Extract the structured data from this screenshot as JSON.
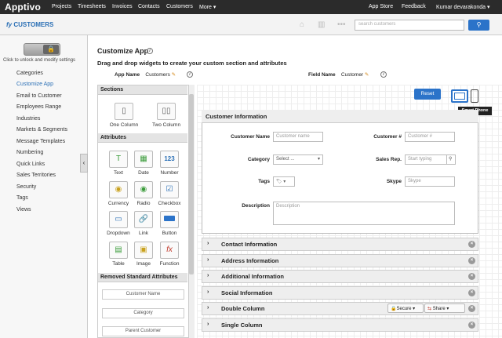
{
  "topnav": {
    "logo": "Apptivo",
    "items": [
      "Projects",
      "Timesheets",
      "Invoices",
      "Contacts",
      "Customers",
      "More ▾"
    ],
    "app_store": "App Store",
    "feedback": "Feedback",
    "user": "Kumar devarakonda ▾"
  },
  "appbar": {
    "title": "CUSTOMERS",
    "search_placeholder": "search customers"
  },
  "sidebar": {
    "unlock_text": "Click to unlock and modify settings",
    "items": [
      "Categories",
      "Customize App",
      "Email to Customer",
      "Employees Range",
      "Industries",
      "Markets & Segments",
      "Message Templates",
      "Numbering",
      "Quick Links",
      "Sales Territories",
      "Security",
      "Tags",
      "Views"
    ],
    "active": "Customize App"
  },
  "main": {
    "title": "Customize App",
    "subtitle": "Drag and drop widgets to create your custom section and attributes",
    "app_name_label": "App Name",
    "app_name_value": "Customers",
    "field_name_label": "Field Name",
    "field_name_value": "Customer"
  },
  "panel": {
    "sections_head": "Sections",
    "sections": [
      "One Column",
      "Two Column"
    ],
    "attributes_head": "Attributes",
    "attributes": [
      "Text",
      "Date",
      "Number",
      "Currency",
      "Radio",
      "Checkbox",
      "Dropdown",
      "Link",
      "Button",
      "Table",
      "Image",
      "Function"
    ],
    "removed_head": "Removed Standard Attributes",
    "removed": [
      "Customer Name",
      "Category",
      "Parent Customer"
    ]
  },
  "canvas": {
    "reset_label": "Reset",
    "tooltip": "Smart Phone",
    "customer_info": {
      "title": "Customer Information",
      "fields": {
        "customer_name_label": "Customer Name",
        "customer_name_placeholder": "Customer name",
        "customer_no_label": "Customer #",
        "customer_no_placeholder": "Customer #",
        "category_label": "Category",
        "category_value": "Select ...",
        "sales_rep_label": "Sales Rep.",
        "sales_rep_placeholder": "Start typing",
        "tags_label": "Tags",
        "skype_label": "Skype",
        "skype_placeholder": "Skype",
        "description_label": "Description",
        "description_placeholder": "Description"
      }
    },
    "sections": [
      "Contact Information",
      "Address Information",
      "Additional Information",
      "Social Information",
      "Double Column",
      "Single Column"
    ],
    "secure_label": "Secure ▾",
    "share_label": "Share ▾"
  },
  "colors": {
    "accent": "#2b73c9",
    "nav_bg": "#2b2b2b",
    "link": "#2a6fb5"
  }
}
